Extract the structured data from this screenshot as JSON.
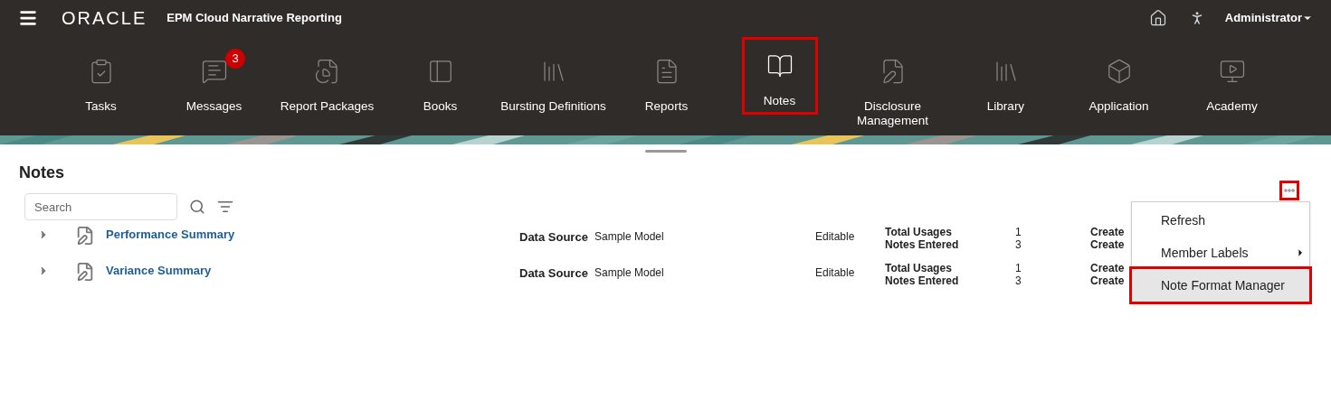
{
  "header": {
    "brand": "ORACLE",
    "app_title": "EPM Cloud Narrative Reporting",
    "user": "Administrator"
  },
  "nav": [
    {
      "label": "Tasks",
      "selected": false
    },
    {
      "label": "Messages",
      "selected": false,
      "badge": "3"
    },
    {
      "label": "Report Packages",
      "selected": false
    },
    {
      "label": "Books",
      "selected": false
    },
    {
      "label": "Bursting Definitions",
      "selected": false
    },
    {
      "label": "Reports",
      "selected": false
    },
    {
      "label": "Notes",
      "selected": true
    },
    {
      "label": "Disclosure Management",
      "selected": false
    },
    {
      "label": "Library",
      "selected": false
    },
    {
      "label": "Application",
      "selected": false
    },
    {
      "label": "Academy",
      "selected": false
    }
  ],
  "page": {
    "title": "Notes",
    "search": {
      "placeholder": "Search"
    },
    "actions_highlighted": true
  },
  "rows": [
    {
      "name": "Performance Summary",
      "source_label": "Data Source",
      "source": "Sample Model",
      "status": "Editable",
      "usage_label": "Total Usages",
      "usage": "1",
      "entered_label": "Notes Entered",
      "entered": "3",
      "created_1": "Create",
      "created_2": "Create"
    },
    {
      "name": "Variance Summary",
      "source_label": "Data Source",
      "source": "Sample Model",
      "status": "Editable",
      "usage_label": "Total Usages",
      "usage": "1",
      "entered_label": "Notes Entered",
      "entered": "3",
      "created_1": "Create",
      "created_2": "Create"
    }
  ],
  "menu": [
    {
      "label": "Refresh",
      "selected": false
    },
    {
      "label": "Member Labels",
      "selected": false,
      "submenu": true
    },
    {
      "label": "Note Format Manager",
      "selected": true
    }
  ]
}
